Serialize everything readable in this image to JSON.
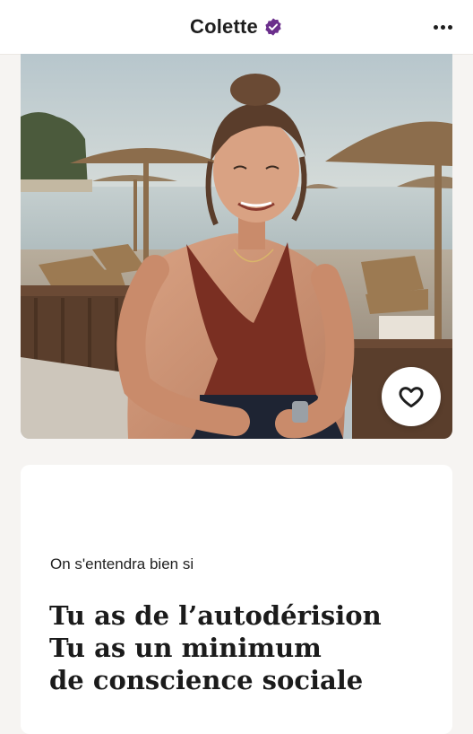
{
  "header": {
    "name": "Colette",
    "verified_icon": "verified-badge-icon",
    "more_icon": "more-options-icon"
  },
  "photo": {
    "description_icon": "profile-photo",
    "like_icon": "heart-outline-icon"
  },
  "prompt": {
    "question": "On s'entendra bien si",
    "answer_lines": [
      "Tu as de l’autodérision",
      "Tu as un minimum",
      "de conscience sociale"
    ]
  },
  "colors": {
    "accent_purple": "#6b2f8c",
    "background": "#f6f4f2",
    "card": "#ffffff"
  }
}
